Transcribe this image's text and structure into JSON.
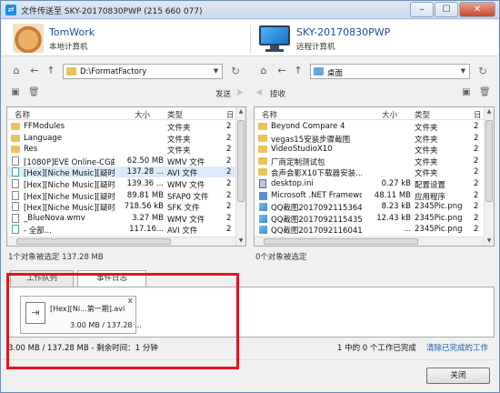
{
  "window": {
    "title": "文件传送至 SKY-20170830PWP (215 660 077)",
    "minimize": "–",
    "maximize": "☐",
    "close": "✕"
  },
  "local": {
    "name": "TomWork",
    "subtitle": "本地计算机"
  },
  "remote": {
    "name": "SKY-20170830PWP",
    "subtitle": "远程计算机"
  },
  "left_pane": {
    "path": "D:\\FormatFactory",
    "send_label": "发送",
    "columns": [
      "名称",
      "大小",
      "类型",
      "日"
    ],
    "rows": [
      {
        "name": "FFModules",
        "size": "",
        "type": "文件夹",
        "date": "2",
        "icon": "folder"
      },
      {
        "name": "Language",
        "size": "",
        "type": "文件夹",
        "date": "2",
        "icon": "folder"
      },
      {
        "name": "Res",
        "size": "",
        "type": "文件夹",
        "date": "2",
        "icon": "folder"
      },
      {
        "name": "[1080P]EVE Online-CG曲...",
        "size": "62.50 MB",
        "type": "WMV 文件",
        "date": "2",
        "icon": "file"
      },
      {
        "name": "[Hex][Niche Music][疑时...",
        "size": "137.28 ...",
        "type": "AVI 文件",
        "date": "2",
        "icon": "media"
      },
      {
        "name": "[Hex][Niche Music][疑时...",
        "size": "139.36 ...",
        "type": "WMV 文件",
        "date": "2",
        "icon": "file"
      },
      {
        "name": "[Hex][Niche Music][疑时...",
        "size": "89.81 MB",
        "type": "SFAP0 文件",
        "date": "2",
        "icon": "file"
      },
      {
        "name": "[Hex][Niche Music][疑时...",
        "size": "718.56 kB",
        "type": "SFK 文件",
        "date": "2",
        "icon": "file"
      },
      {
        "name": "_BlueNova.wmv",
        "size": "3.27 MB",
        "type": "WMV 文件",
        "date": "2",
        "icon": "file"
      },
      {
        "name": "- 全部...",
        "size": "117.16...",
        "type": "AVI 文件",
        "date": "2",
        "icon": "media"
      }
    ],
    "selection_status": "1个对象被选定 137.28 MB"
  },
  "right_pane": {
    "path": "桌面",
    "receive_label": "接收",
    "columns": [
      "名称",
      "大小",
      "类型",
      "日"
    ],
    "rows": [
      {
        "name": "Beyond Compare 4",
        "size": "",
        "type": "文件夹",
        "date": "2",
        "icon": "folder"
      },
      {
        "name": "vegas15安装步骤截图",
        "size": "",
        "type": "文件夹",
        "date": "2",
        "icon": "folder"
      },
      {
        "name": "VideoStudioX10",
        "size": "",
        "type": "文件夹",
        "date": "2",
        "icon": "folder"
      },
      {
        "name": "厂商定制测试包",
        "size": "",
        "type": "文件夹",
        "date": "2",
        "icon": "folder"
      },
      {
        "name": "会声会影X10下载器安装...",
        "size": "",
        "type": "文件夹",
        "date": "2",
        "icon": "folder"
      },
      {
        "name": "desktop.ini",
        "size": "0.27 kB",
        "type": "配置设置",
        "date": "2",
        "icon": "cfg"
      },
      {
        "name": "Microsoft .NET Framewor...",
        "size": "48.11 MB",
        "type": "应用程序",
        "date": "2",
        "icon": "ms"
      },
      {
        "name": "QQ截图20170921153648.p...",
        "size": "8.23 kB",
        "type": "2345Pic.png",
        "date": "2",
        "icon": "img"
      },
      {
        "name": "QQ截图20170921154350.p...",
        "size": "12.43 kB",
        "type": "2345Pic.png",
        "date": "2",
        "icon": "img"
      },
      {
        "name": "QQ截图20170921160418.p...",
        "size": "...",
        "type": "2345Pic.png",
        "date": "2",
        "icon": "img"
      }
    ],
    "selection_status": "0个对象被选定"
  },
  "tabs": [
    {
      "label": "工作队列",
      "active": false
    },
    {
      "label": "事件日志",
      "active": true
    }
  ],
  "job": {
    "name": "[Hex][Ni...第一期].avi",
    "progress": "3.00 MB / 137.28 ...",
    "close": "x"
  },
  "status": {
    "transfer": "3.00 MB / 137.28 MB - 剩余时间：1 分钟",
    "jobs": "1 中的 0 个工作已完成",
    "clear_link": "清除已完成的工作"
  },
  "close_button": "关闭",
  "colors": {
    "highlight": "#e0161d",
    "link": "#1a5fb4",
    "selected_row": "#dcebfc"
  }
}
